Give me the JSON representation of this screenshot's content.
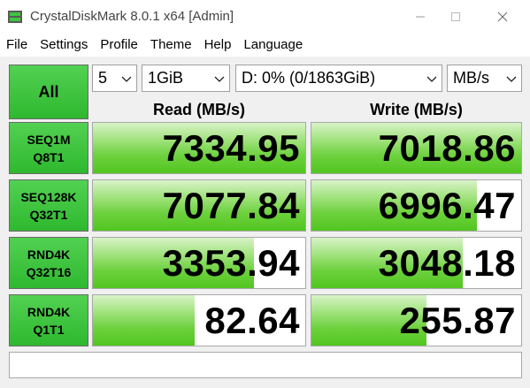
{
  "window": {
    "title": "CrystalDiskMark 8.0.1 x64 [Admin]"
  },
  "menu": {
    "items": [
      {
        "label": "File"
      },
      {
        "label": "Settings"
      },
      {
        "label": "Profile"
      },
      {
        "label": "Theme"
      },
      {
        "label": "Help"
      },
      {
        "label": "Language"
      }
    ]
  },
  "controls": {
    "all_label": "All",
    "test_count": "5",
    "test_size": "1GiB",
    "drive": "D: 0% (0/1863GiB)",
    "unit": "MB/s"
  },
  "headers": {
    "read": "Read (MB/s)",
    "write": "Write (MB/s)"
  },
  "tests": [
    {
      "line1": "SEQ1M",
      "line2": "Q8T1",
      "read": "7334.95",
      "write": "7018.86",
      "read_fill": 1.0,
      "write_fill": 1.0
    },
    {
      "line1": "SEQ128K",
      "line2": "Q32T1",
      "read": "7077.84",
      "write": "6996.47",
      "read_fill": 1.0,
      "write_fill": 0.79
    },
    {
      "line1": "RND4K",
      "line2": "Q32T16",
      "read": "3353.94",
      "write": "3048.18",
      "read_fill": 0.76,
      "write_fill": 0.72
    },
    {
      "line1": "RND4K",
      "line2": "Q1T1",
      "read": "82.64",
      "write": "255.87",
      "read_fill": 0.48,
      "write_fill": 0.55
    }
  ],
  "comment": "",
  "colors": {
    "accent_green": "#2fb82f",
    "bar_green": "#52c620"
  }
}
